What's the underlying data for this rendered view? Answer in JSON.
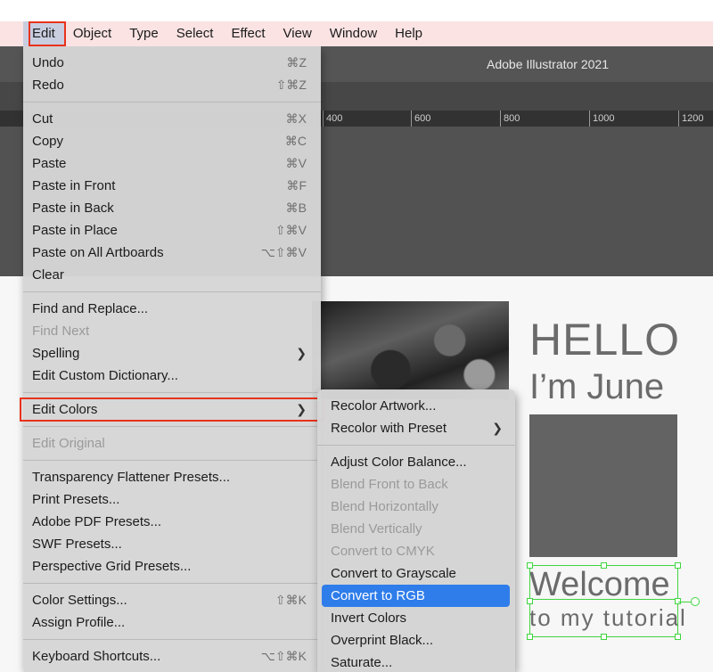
{
  "menubar": {
    "items": [
      "Edit",
      "Object",
      "Type",
      "Select",
      "Effect",
      "View",
      "Window",
      "Help"
    ]
  },
  "app": {
    "title": "Adobe Illustrator 2021"
  },
  "ruler": {
    "ticks": [
      "400",
      "600",
      "800",
      "1000",
      "1200"
    ]
  },
  "artwork": {
    "hello": "HELLO",
    "june": "I’m June",
    "welcome": "Welcome",
    "tutorial": "to my tutorial"
  },
  "edit_menu": {
    "undo": "Undo",
    "undo_sc": "⌘Z",
    "redo": "Redo",
    "redo_sc": "⇧⌘Z",
    "cut": "Cut",
    "cut_sc": "⌘X",
    "copy": "Copy",
    "copy_sc": "⌘C",
    "paste": "Paste",
    "paste_sc": "⌘V",
    "paste_front": "Paste in Front",
    "paste_front_sc": "⌘F",
    "paste_back": "Paste in Back",
    "paste_back_sc": "⌘B",
    "paste_place": "Paste in Place",
    "paste_place_sc": "⇧⌘V",
    "paste_all": "Paste on All Artboards",
    "paste_all_sc": "⌥⇧⌘V",
    "clear": "Clear",
    "find_replace": "Find and Replace...",
    "find_next": "Find Next",
    "spelling": "Spelling",
    "edit_dictionary": "Edit Custom Dictionary...",
    "edit_colors": "Edit Colors",
    "edit_original": "Edit Original",
    "transparency_presets": "Transparency Flattener Presets...",
    "print_presets": "Print Presets...",
    "pdf_presets": "Adobe PDF Presets...",
    "swf_presets": "SWF Presets...",
    "perspective_presets": "Perspective Grid Presets...",
    "color_settings": "Color Settings...",
    "color_settings_sc": "⇧⌘K",
    "assign_profile": "Assign Profile...",
    "keyboard_shortcuts": "Keyboard Shortcuts...",
    "keyboard_shortcuts_sc": "⌥⇧⌘K"
  },
  "colors_submenu": {
    "recolor_artwork": "Recolor Artwork...",
    "recolor_preset": "Recolor with Preset",
    "adjust_balance": "Adjust Color Balance...",
    "blend_front_back": "Blend Front to Back",
    "blend_horizontal": "Blend Horizontally",
    "blend_vertical": "Blend Vertically",
    "convert_cmyk": "Convert to CMYK",
    "convert_grayscale": "Convert to Grayscale",
    "convert_rgb": "Convert to RGB",
    "invert_colors": "Invert Colors",
    "overprint_black": "Overprint Black...",
    "saturate": "Saturate..."
  },
  "colors": {
    "highlight_red": "#e8331d",
    "selection_blue": "#2f7dea",
    "selection_green": "#3fd53f"
  }
}
